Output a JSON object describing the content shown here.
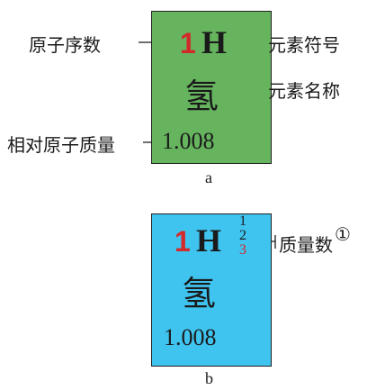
{
  "colors": {
    "card_a": "#66b45e",
    "card_b": "#3fc4ef",
    "atomic_number": "#d22a2a"
  },
  "card_a": {
    "atomic_number": "1",
    "symbol": "H",
    "name": "氢",
    "mass": "1.008",
    "caption": "a"
  },
  "card_b": {
    "atomic_number": "1",
    "symbol": "H",
    "isotopes": [
      "1",
      "2",
      "3"
    ],
    "name": "氢",
    "mass": "1.008",
    "caption": "b"
  },
  "labels": {
    "atomic_number": "原子序数",
    "element_symbol": "元素符号",
    "element_name": "元素名称",
    "relative_atomic_mass": "相对原子质量",
    "mass_number": "质量数",
    "footnote": "①"
  }
}
